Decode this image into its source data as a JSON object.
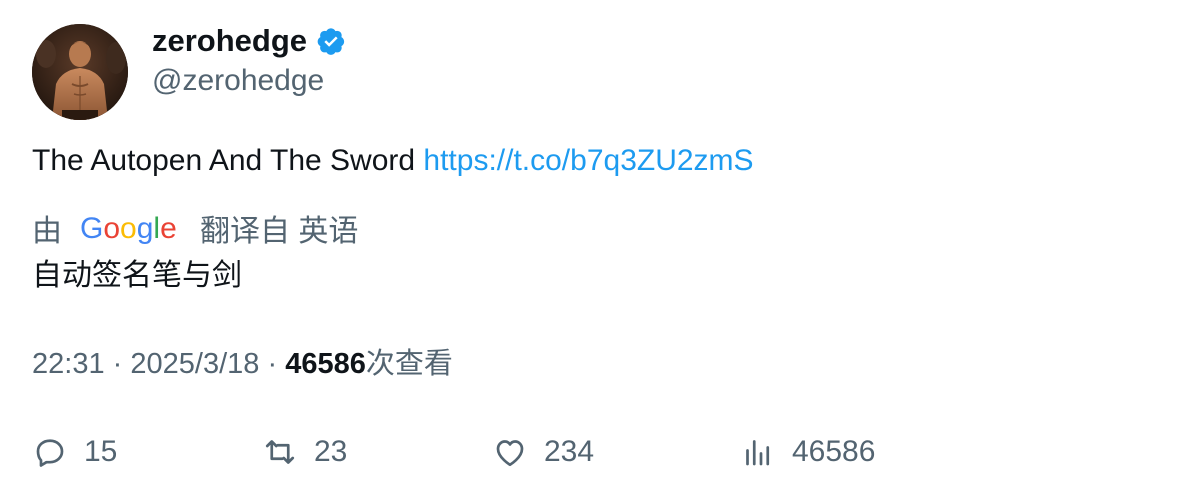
{
  "author": {
    "display_name": "zerohedge",
    "handle": "@zerohedge",
    "verified": true
  },
  "tweet": {
    "text": "The Autopen And The Sword",
    "link": "https://t.co/b7q3ZU2zmS"
  },
  "translation": {
    "prefix": "由",
    "provider": "Google",
    "suffix": "翻译自 英语",
    "translated_text": "自动签名笔与剑"
  },
  "meta": {
    "time": "22:31",
    "separator": "·",
    "date": "2025/3/18",
    "views_count": "46586",
    "views_label": "次查看"
  },
  "actions": {
    "replies": "15",
    "retweets": "23",
    "likes": "234",
    "views": "46586"
  },
  "colors": {
    "link": "#1d9bf0",
    "verified": "#1d9bf0",
    "secondary_text": "#536471",
    "primary_text": "#0f1419"
  }
}
